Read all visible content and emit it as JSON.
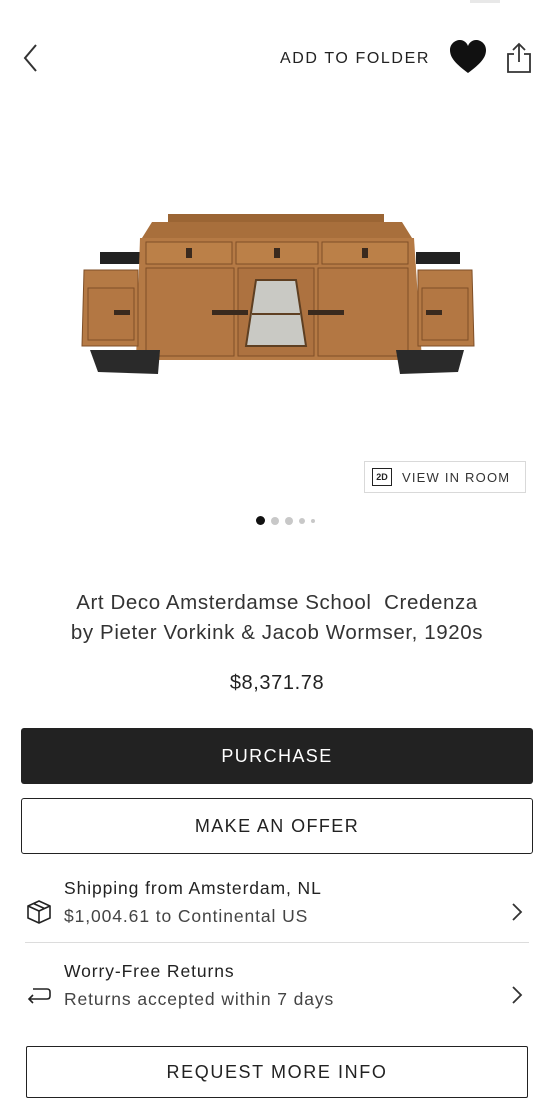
{
  "header": {
    "add_to_folder_label": "ADD TO FOLDER",
    "back_icon": "chevron-left-icon",
    "favorite_icon": "heart-icon",
    "share_icon": "share-icon"
  },
  "gallery": {
    "view_in_room_badge": "2D",
    "view_in_room_label": "VIEW IN ROOM",
    "active_index": 0,
    "total_dots": 5
  },
  "product": {
    "title_line1": "Art Deco Amsterdamse School  Credenza",
    "title_line2": "by Pieter Vorkink & Jacob Wormser, 1920s",
    "price": "$8,371.78"
  },
  "actions": {
    "purchase_label": "PURCHASE",
    "offer_label": "MAKE AN OFFER",
    "request_info_label": "REQUEST MORE INFO"
  },
  "shipping": {
    "title": "Shipping from Amsterdam, NL",
    "subtitle": "$1,004.61 to Continental US",
    "icon": "package-icon"
  },
  "returns": {
    "title": "Worry-Free Returns",
    "subtitle": "Returns accepted within 7 days",
    "icon": "return-arrow-icon"
  },
  "colors": {
    "primary": "#222222",
    "wood": "#b57a45",
    "wood_dark": "#8e5a2e",
    "background": "#ffffff"
  }
}
